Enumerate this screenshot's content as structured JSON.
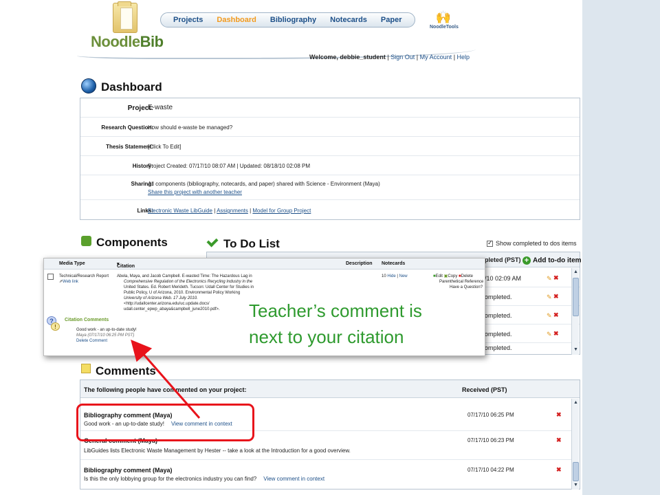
{
  "header": {
    "logo_text_1": "Noodle",
    "logo_text_2": "Bib",
    "tabs": [
      "Projects",
      "Dashboard",
      "Bibliography",
      "Notecards",
      "Paper"
    ],
    "active_tab": "Dashboard",
    "brand_right": "NoodleTools",
    "welcome": "Welcome, debbie_student",
    "sign_out": "Sign Out",
    "my_account": "My Account",
    "help": "Help",
    "separator": "|"
  },
  "dashboard": {
    "title": "Dashboard",
    "rows": {
      "project_label": "Project:",
      "project_value": "E-waste",
      "rq_label": "Research Question:",
      "rq_value": "How should e-waste be managed?",
      "thesis_label": "Thesis Statement:",
      "thesis_value": "[Click To Edit]",
      "history_label": "History:",
      "history_value": "Project Created: 07/17/10 08:07 AM | Updated: 08/18/10 02:08 PM",
      "sharing_label": "Sharing:",
      "sharing_value": "All components (bibliography, notecards, and paper) shared with Science - Environment (Maya)",
      "sharing_link": "Share this project with another teacher",
      "links_label": "Links:",
      "links": [
        "Electronic Waste LibGuide",
        "Assignments",
        "Model for Group Project"
      ]
    }
  },
  "components": {
    "title": "Components"
  },
  "todo": {
    "title": "To Do List",
    "show_completed": "Show completed to dos items",
    "show_completed_checked": true,
    "col_completed": "pleted (PST)",
    "add_item": "Add to-do item",
    "rows": [
      "/10 02:09 AM",
      "ompleted.",
      "ompleted.",
      "ompleted.",
      "ompleted."
    ]
  },
  "overlay": {
    "headers": {
      "media_type": "Media Type",
      "citation": "Citation",
      "description": "Description",
      "notecards": "Notecards"
    },
    "media_type": "Technical/Research Report",
    "web_link": "Web link",
    "citation_lines": [
      "Abela, Maya, and Jacob Campbell. E-wasted Time: The Hazardous Lag in",
      "Comprehensive Regulation of the Electronics Recycling Industry in the",
      "United States. Ed. Robert Merideth. Tucson: Udall Center for Studies in",
      "Public Policy, U of Arizona, 2010. Environmental Policy Working",
      "University of Arizona Web. 17 July 2010.",
      "<http://udallcenter.arizona.edu/uc.update.docs/",
      "udall.center_epwp_abaya&campbell_june2010.pdf>."
    ],
    "notecards": "10",
    "hide": "Hide",
    "new": "New",
    "actions": [
      "Edit",
      "Copy",
      "Delete"
    ],
    "parenthetical": "Parenthetical Reference",
    "have_question": "Have a Question?",
    "citation_comments_title": "Citation Comments",
    "comment_text": "Good work - an up-to-date study!",
    "comment_meta": "Maya (07/17/10 06:25 PM PST)",
    "delete_comment": "Delete Comment"
  },
  "callout": {
    "line1": "Teacher’s  comment is",
    "line2": "next to your citation"
  },
  "comments": {
    "title": "Comments",
    "header_left": "The following people have commented on your project:",
    "header_right": "Received (PST)",
    "view_link": "View comment in context",
    "items": [
      {
        "title": "Bibliography comment (Maya)",
        "body": "Good work - an up-to-date study!",
        "date": "07/17/10 06:25 PM",
        "has_link": true
      },
      {
        "title": "General comment (Maya)",
        "body": "LibGuides lists Electronic Waste Management by Hester -- take a look at the Introduction for a good overview.",
        "date": "07/17/10 06:23 PM",
        "has_link": false
      },
      {
        "title": "Bibliography comment (Maya)",
        "body": "Is this the only lobbying group for the electronics industry you can find?",
        "date": "07/17/10 04:22 PM",
        "has_link": true
      }
    ]
  },
  "colors": {
    "accent_tab": "#f39a1d",
    "link": "#1c4f88",
    "callout_green": "#2e9a2e",
    "highlight_red": "#e8131b"
  }
}
